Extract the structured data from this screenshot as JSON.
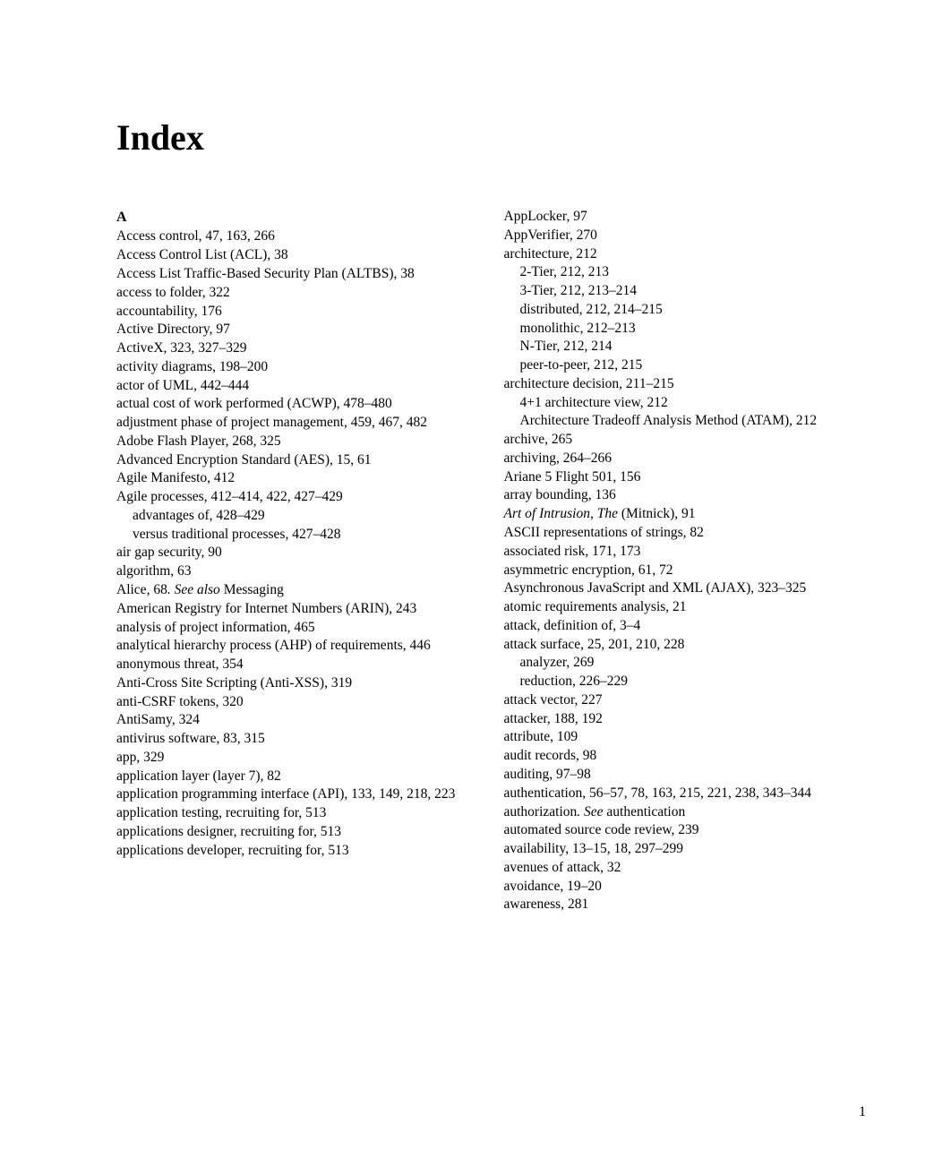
{
  "title": "Index",
  "page_number": "1",
  "columns": [
    {
      "section_letter": "A",
      "entries": [
        {
          "type": "entry",
          "text": "Access control, 47, 163, 266"
        },
        {
          "type": "entry",
          "text": "Access Control List (ACL), 38"
        },
        {
          "type": "entry",
          "text": "Access List Traffic-Based Security Plan (ALTBS), 38"
        },
        {
          "type": "entry",
          "text": "access to folder, 322"
        },
        {
          "type": "entry",
          "text": "accountability, 176"
        },
        {
          "type": "entry",
          "text": "Active Directory, 97"
        },
        {
          "type": "entry",
          "text": "ActiveX, 323, 327–329"
        },
        {
          "type": "entry",
          "text": "activity diagrams, 198–200"
        },
        {
          "type": "entry",
          "text": "actor of UML, 442–444"
        },
        {
          "type": "entry",
          "text": "actual cost of work performed (ACWP), 478–480"
        },
        {
          "type": "entry",
          "text": "adjustment phase of project management, 459, 467, 482"
        },
        {
          "type": "entry",
          "text": "Adobe Flash Player, 268, 325"
        },
        {
          "type": "entry",
          "text": "Advanced Encryption Standard (AES), 15, 61"
        },
        {
          "type": "entry",
          "text": "Agile Manifesto, 412"
        },
        {
          "type": "entry",
          "text": "Agile processes, 412–414, 422, 427–429"
        },
        {
          "type": "sub-entry",
          "text": "advantages of, 428–429"
        },
        {
          "type": "sub-entry",
          "text": "versus traditional processes, 427–428"
        },
        {
          "type": "entry",
          "text": "air gap security, 90"
        },
        {
          "type": "entry",
          "text": "algorithm, 63"
        },
        {
          "type": "entry",
          "text_prefix": "Alice, 68",
          "see_also": ". See also ",
          "ref": "Messaging"
        },
        {
          "type": "entry",
          "text": "American Registry for Internet Numbers (ARIN), 243"
        },
        {
          "type": "entry",
          "text": "analysis of project information, 465"
        },
        {
          "type": "entry",
          "text": "analytical hierarchy process (AHP) of requirements, 446"
        },
        {
          "type": "entry",
          "text": "anonymous threat, 354"
        },
        {
          "type": "entry",
          "text": "Anti-Cross Site Scripting (Anti-XSS), 319"
        },
        {
          "type": "entry",
          "text": "anti-CSRF tokens, 320"
        },
        {
          "type": "entry",
          "text": "AntiSamy, 324"
        },
        {
          "type": "entry",
          "text": "antivirus software, 83, 315"
        },
        {
          "type": "entry",
          "text": "app, 329"
        },
        {
          "type": "entry",
          "text": "application layer (layer 7), 82"
        },
        {
          "type": "entry",
          "text": "application programming interface (API), 133, 149, 218, 223"
        },
        {
          "type": "entry",
          "text": "application testing, recruiting for, 513"
        },
        {
          "type": "entry",
          "text": "applications designer, recruiting for, 513"
        },
        {
          "type": "entry",
          "text": "applications developer, recruiting for, 513"
        }
      ]
    },
    {
      "section_letter": "",
      "entries": [
        {
          "type": "entry",
          "text": "AppLocker, 97"
        },
        {
          "type": "entry",
          "text": "AppVerifier, 270"
        },
        {
          "type": "entry",
          "text": "architecture, 212"
        },
        {
          "type": "sub-entry",
          "text": "2-Tier, 212, 213"
        },
        {
          "type": "sub-entry",
          "text": "3-Tier, 212, 213–214"
        },
        {
          "type": "sub-entry",
          "text": "distributed, 212, 214–215"
        },
        {
          "type": "sub-entry",
          "text": "monolithic, 212–213"
        },
        {
          "type": "sub-entry",
          "text": "N-Tier, 212, 214"
        },
        {
          "type": "sub-entry",
          "text": "peer-to-peer, 212, 215"
        },
        {
          "type": "entry",
          "text": "architecture decision, 211–215"
        },
        {
          "type": "sub-entry",
          "text": "4+1 architecture view, 212"
        },
        {
          "type": "sub-entry",
          "text": "Architecture Tradeoff Analysis Method (ATAM), 212"
        },
        {
          "type": "entry",
          "text": "archive, 265"
        },
        {
          "type": "entry",
          "text": "archiving, 264–266"
        },
        {
          "type": "entry",
          "text": "Ariane 5 Flight 501, 156"
        },
        {
          "type": "entry",
          "text": "array bounding, 136"
        },
        {
          "type": "entry",
          "italic_title": "Art of Intrusion, The",
          "text_after": " (Mitnick), 91"
        },
        {
          "type": "entry",
          "text": "ASCII representations of strings, 82"
        },
        {
          "type": "entry",
          "text": "associated risk, 171, 173"
        },
        {
          "type": "entry",
          "text": "asymmetric encryption, 61, 72"
        },
        {
          "type": "entry",
          "text": "Asynchronous JavaScript and XML (AJAX), 323–325"
        },
        {
          "type": "entry",
          "text": "atomic requirements analysis, 21"
        },
        {
          "type": "entry",
          "text": "attack, definition of, 3–4"
        },
        {
          "type": "entry",
          "text": "attack surface, 25, 201, 210, 228"
        },
        {
          "type": "sub-entry",
          "text": "analyzer, 269"
        },
        {
          "type": "sub-entry",
          "text": "reduction, 226–229"
        },
        {
          "type": "entry",
          "text": "attack vector, 227"
        },
        {
          "type": "entry",
          "text": "attacker, 188, 192"
        },
        {
          "type": "entry",
          "text": "attribute, 109"
        },
        {
          "type": "entry",
          "text": "audit records, 98"
        },
        {
          "type": "entry",
          "text": "auditing, 97–98"
        },
        {
          "type": "entry",
          "text": "authentication, 56–57, 78, 163, 215, 221, 238, 343–344"
        },
        {
          "type": "entry",
          "text_prefix": "authorization",
          "see": ". See ",
          "ref": "authentication"
        },
        {
          "type": "entry",
          "text": "automated source code review, 239"
        },
        {
          "type": "entry",
          "text": "availability, 13–15, 18, 297–299"
        },
        {
          "type": "entry",
          "text": "avenues of attack, 32"
        },
        {
          "type": "entry",
          "text": "avoidance, 19–20"
        },
        {
          "type": "entry",
          "text": "awareness, 281"
        }
      ]
    }
  ]
}
